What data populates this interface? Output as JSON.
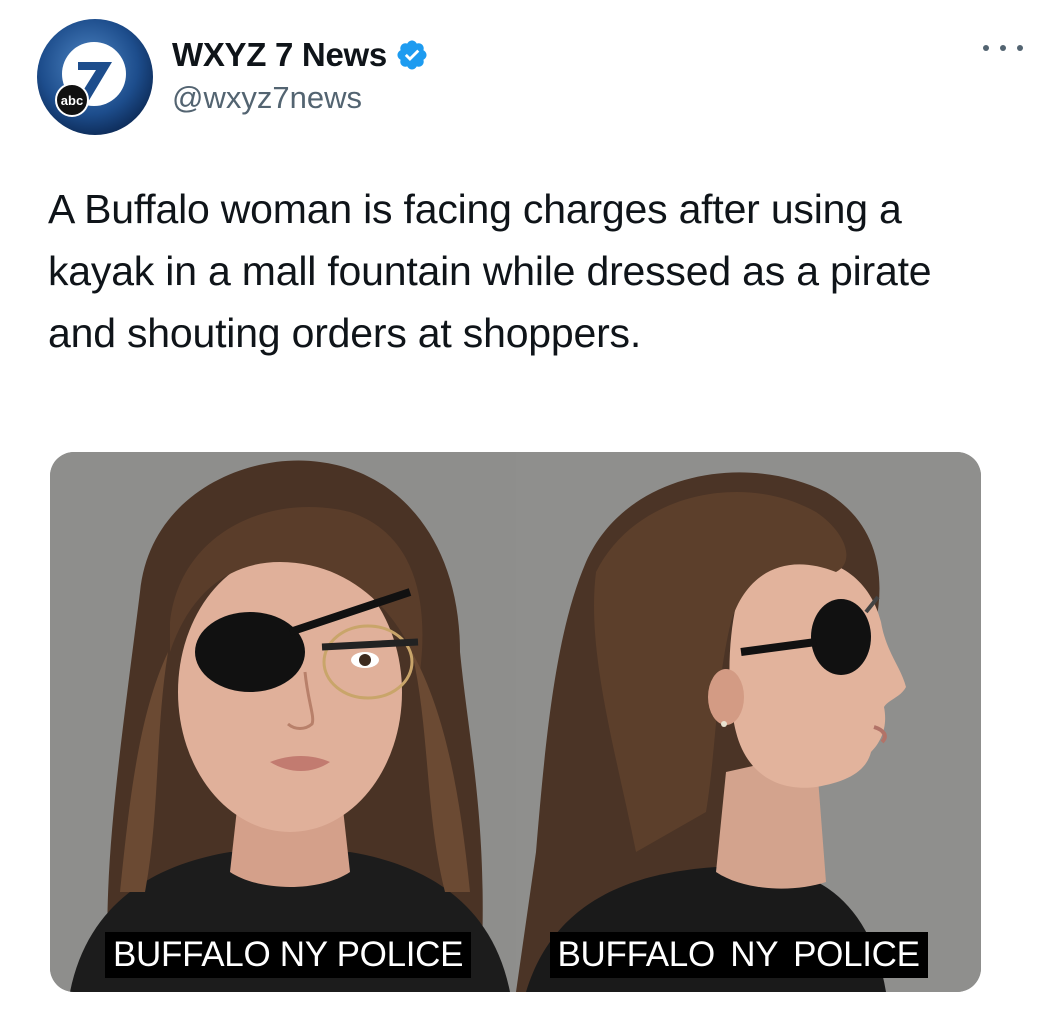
{
  "author": {
    "display_name": "WXYZ 7 News",
    "handle": "@wxyz7news",
    "avatar_text": "7",
    "avatar_badge": "abc",
    "verified": true
  },
  "tweet": {
    "text": "A Buffalo woman is facing charges after using a kayak in a mall fountain while dressed as a pirate and shouting orders at shoppers."
  },
  "media": {
    "photos": [
      {
        "view": "front",
        "caption": "BUFFALO NY POLICE"
      },
      {
        "view": "profile",
        "caption": "BUFFALO NY POLICE"
      }
    ]
  },
  "icons": {
    "more": "more-horizontal-icon",
    "verified": "verified-badge-icon"
  },
  "colors": {
    "verified_blue": "#1d9bf0",
    "text_primary": "#0f1419",
    "text_secondary": "#536471",
    "mugshot_background": "#8e8e8c"
  }
}
